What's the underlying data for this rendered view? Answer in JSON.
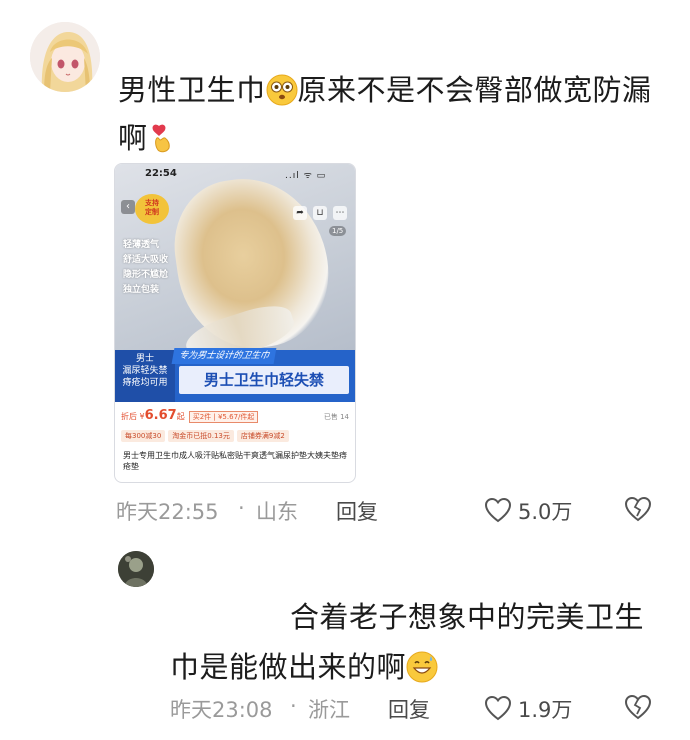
{
  "comment1": {
    "text_part1": "男性卫生巾",
    "text_part2": "原来不是不会臀部做宽防漏啊",
    "time": "昨天22:55",
    "location": "山东",
    "reply_label": "回复",
    "like_count": "5.0万",
    "avatar_icon": "anime-girl-avatar"
  },
  "product_screenshot": {
    "status_time": "22:54",
    "status_icons": "..ıl ᯤ ▭",
    "badge_line1": "支持",
    "badge_line2": "定制",
    "pager": "1/5",
    "features": [
      "轻薄透气",
      "舒适大吸收",
      "隐形不尴尬",
      "独立包装"
    ],
    "side_tags": [
      "男士",
      "漏尿轻失禁",
      "痔疮均可用"
    ],
    "slogan_small": "专为男士设计的卫生巾",
    "slogan_big": "男士卫生巾轻失禁",
    "price_prefix": "折后 ¥",
    "price": "6.67",
    "price_suffix": "起",
    "price_promo": "买2件 | ¥5.67/件起",
    "sold": "已售 14",
    "coupons": [
      "每300减30",
      "淘金币已抵0.13元",
      "店铺券满9减2"
    ],
    "title": "男士专用卫生巾成人吸汗贴私密贴干爽透气漏尿护垫大姨夫垫痔疮垫"
  },
  "comment2": {
    "line1": "合着老子想象中的完美卫生",
    "line2": "巾是能做出来的啊",
    "time": "昨天23:08",
    "location": "浙江",
    "reply_label": "回复",
    "like_count": "1.9万",
    "avatar_icon": "dark-photo-avatar"
  },
  "separator": "·",
  "colors": {
    "text": "#1c1c1c",
    "meta": "#9a9a9a",
    "accent_blue": "#2563c9",
    "price_red": "#e34d2e"
  }
}
